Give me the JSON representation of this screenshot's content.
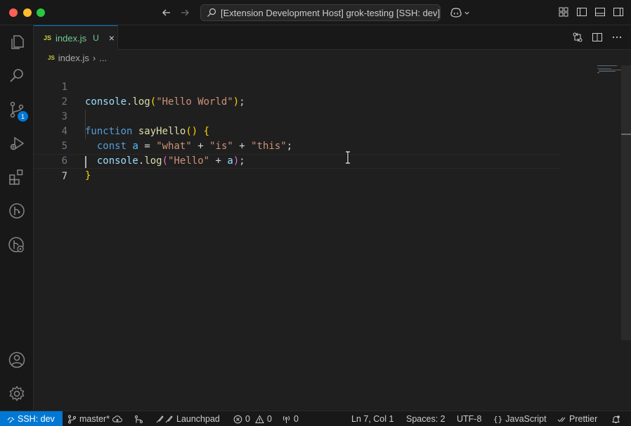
{
  "titlebar": {
    "command_center": "[Extension Development Host] grok-testing [SSH: dev]"
  },
  "activity": {
    "scm_badge": "1"
  },
  "tab": {
    "icon": "JS",
    "name": "index.js",
    "status": "U",
    "close": "×"
  },
  "breadcrumb": {
    "icon": "JS",
    "file": "index.js",
    "separator": "›",
    "more": "..."
  },
  "editor": {
    "line_numbers": [
      "1",
      "2",
      "3",
      "4",
      "5",
      "6",
      "7"
    ],
    "current_line": 7
  },
  "statusbar": {
    "remote": "SSH: dev",
    "branch": "master*",
    "launchpad": "Launchpad",
    "errors": "0",
    "warnings": "0",
    "ports": "0",
    "position": "Ln 7, Col 1",
    "spaces": "Spaces: 2",
    "encoding": "UTF-8",
    "language": "JavaScript",
    "formatter": "Prettier"
  },
  "colors": {
    "accent": "#0078d4",
    "modified_green": "#73c991"
  }
}
